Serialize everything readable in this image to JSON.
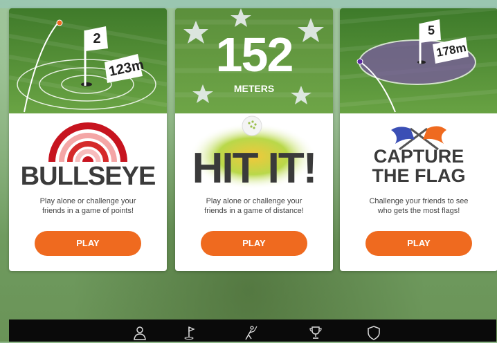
{
  "cards": [
    {
      "id": "bullseye",
      "title": "BULLSEYE",
      "hole_number": "2",
      "distance": "123m",
      "description_lines": [
        "Play alone or challenge your",
        "friends in a game of points!"
      ],
      "play_label": "PLAY"
    },
    {
      "id": "hit-it",
      "title": "HIT IT!",
      "stat_value": "152",
      "stat_unit": "METERS",
      "description_lines": [
        "Play alone or challenge your",
        "friends in a game of distance!"
      ],
      "play_label": "PLAY"
    },
    {
      "id": "capture-the-flag",
      "title_lines": [
        "CAPTURE",
        "THE FLAG"
      ],
      "hole_number": "5",
      "distance": "178m",
      "description_lines": [
        "Challenge your friends to see",
        "who gets the most flags!"
      ],
      "play_label": "PLAY"
    }
  ],
  "nav": [
    "profile-icon",
    "course-flag-icon",
    "golfer-icon",
    "trophy-icon",
    "shield-icon"
  ],
  "colors": {
    "accent": "#ef6a1f",
    "bar": "#0a0a0a"
  }
}
